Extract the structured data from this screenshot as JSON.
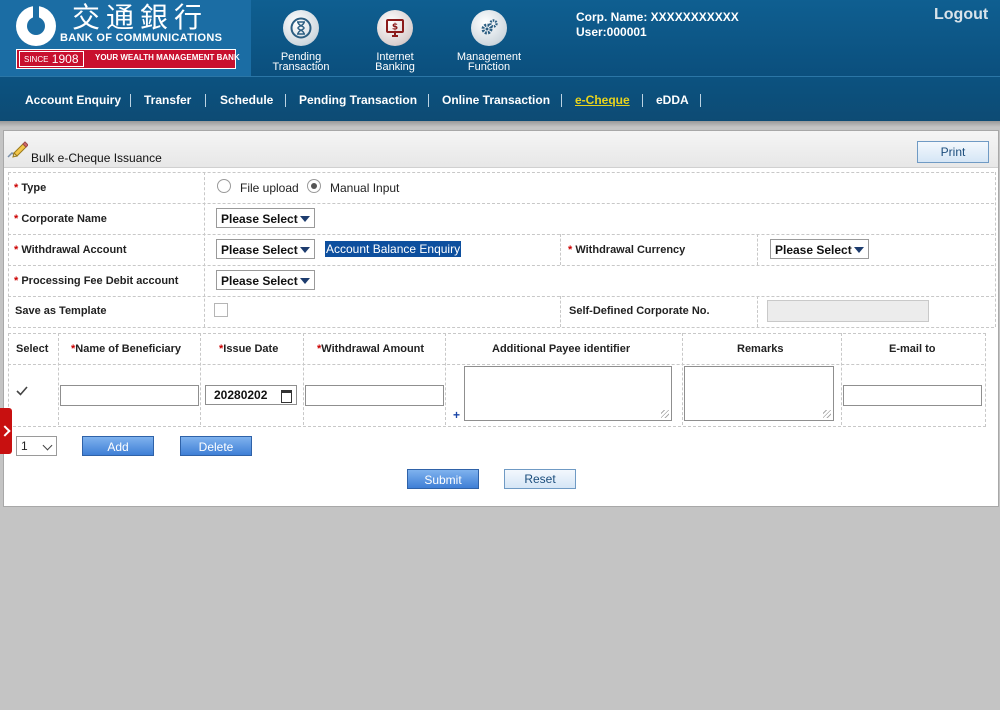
{
  "header": {
    "logo_cn": "交通銀行",
    "logo_en": "BANK OF COMMUNICATIONS",
    "since": "SINCE",
    "since_year": "1908",
    "tagline": "YOUR WEALTH MANAGEMENT BANK",
    "nav": [
      {
        "label": "Pending\nTransaction",
        "icon": "hourglass-icon"
      },
      {
        "label": "Internet\nBanking",
        "icon": "monitor-dollar-icon"
      },
      {
        "label": "Management\nFunction",
        "icon": "gears-icon"
      }
    ],
    "corp_name": "Corp. Name: XXXXXXXXXXX",
    "user": "User:000001",
    "logout": "Logout"
  },
  "menu": {
    "items": [
      {
        "label": "Account Enquiry"
      },
      {
        "label": "Transfer"
      },
      {
        "label": "Schedule"
      },
      {
        "label": "Pending Transaction"
      },
      {
        "label": "Online Transaction"
      },
      {
        "label": "e-Cheque",
        "active": true
      },
      {
        "label": "eDDA"
      }
    ],
    "separator": "|"
  },
  "panel": {
    "title": "Bulk e-Cheque Issuance",
    "print": "Print"
  },
  "form": {
    "type_label": "Type",
    "type_options": [
      {
        "label": "File upload",
        "selected": false
      },
      {
        "label": "Manual Input",
        "selected": true
      }
    ],
    "corporate_name_label": "Corporate Name",
    "corporate_name_value": "Please Select",
    "withdrawal_account_label": "Withdrawal Account",
    "withdrawal_account_value": "Please Select",
    "balance_enquiry": "Account Balance Enquiry",
    "withdrawal_currency_label": "Withdrawal Currency",
    "withdrawal_currency_value": "Please Select",
    "fee_account_label": "Processing Fee Debit account",
    "fee_account_value": "Please Select",
    "save_template_label": "Save as Template",
    "self_defined_label": "Self-Defined Corporate No.",
    "required_mark": "*"
  },
  "grid": {
    "columns": {
      "select": "Select",
      "beneficiary": "Name of Beneficiary",
      "issue_date": "Issue Date",
      "amount": "Withdrawal Amount",
      "payee_id": "Additional Payee identifier",
      "remarks": "Remarks",
      "email": "E-mail to"
    },
    "row": {
      "selected": true,
      "issue_date": "20280202",
      "plus": "+"
    },
    "page_value": "1",
    "add": "Add",
    "delete": "Delete",
    "submit": "Submit",
    "reset": "Reset"
  },
  "colors": {
    "header_blue": "#0f5f91",
    "active_menu": "#e8d31c",
    "required": "#cc0000",
    "button_blue": "#3f7fd6",
    "side_tab_red": "#c81010"
  }
}
